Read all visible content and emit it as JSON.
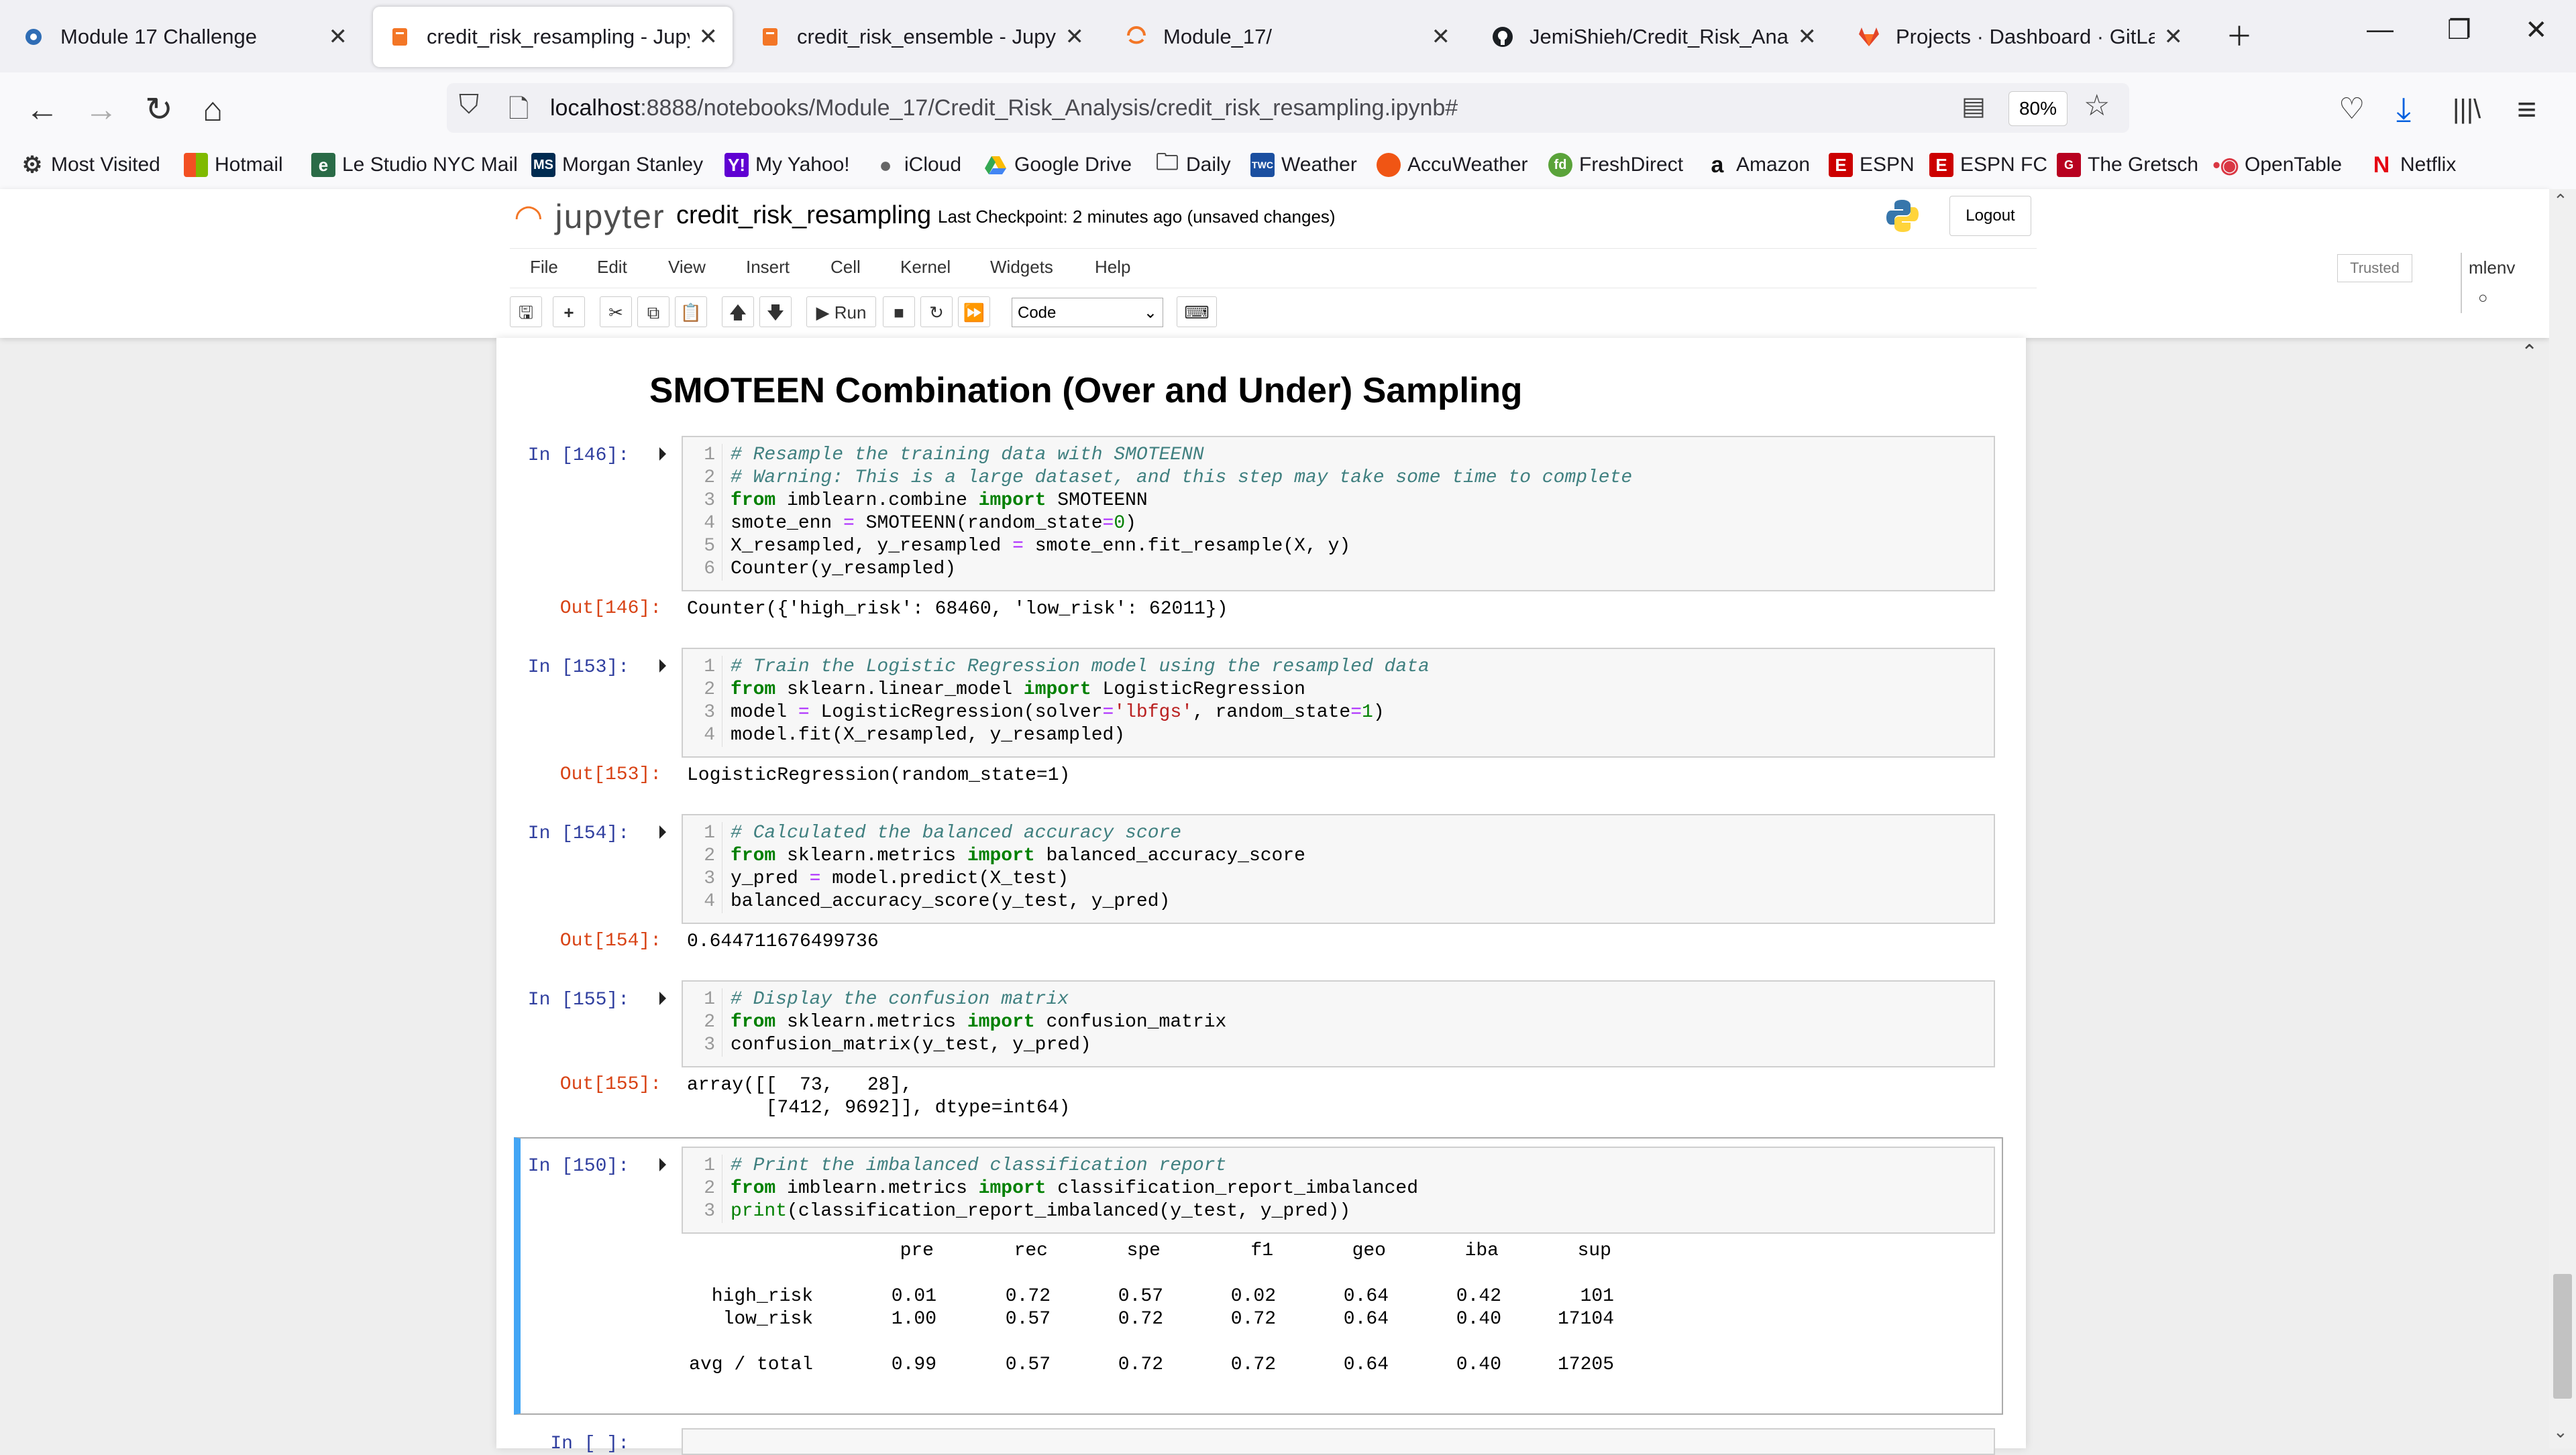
{
  "browser": {
    "tabs": [
      {
        "label": "Module 17 Challenge",
        "icon": "app-icon"
      },
      {
        "label": "credit_risk_resampling - Jupyte",
        "icon": "jupyter-icon",
        "active": true
      },
      {
        "label": "credit_risk_ensemble - Jupyter",
        "icon": "jupyter-icon"
      },
      {
        "label": "Module_17/",
        "icon": "jupyter-loading-icon"
      },
      {
        "label": "JemiShieh/Credit_Risk_Analysis",
        "icon": "github-icon"
      },
      {
        "label": "Projects · Dashboard · GitLab",
        "icon": "gitlab-icon"
      }
    ],
    "url_host": "localhost",
    "url_rest": ":8888/notebooks/Module_17/Credit_Risk_Analysis/credit_risk_resampling.ipynb#",
    "zoom": "80%",
    "bookmarks": [
      "Most Visited",
      "Hotmail",
      "Le Studio NYC Mail",
      "Morgan Stanley",
      "My Yahoo!",
      "iCloud",
      "Google Drive",
      "Daily",
      "Weather",
      "AccuWeather",
      "FreshDirect",
      "Amazon",
      "ESPN",
      "ESPN FC",
      "The Gretsch",
      "OpenTable",
      "Netflix"
    ]
  },
  "jupyter": {
    "logo": "jupyter",
    "notebook_name": "credit_risk_resampling",
    "checkpoint": "Last Checkpoint: 2 minutes ago  (unsaved changes)",
    "logout": "Logout",
    "menu": [
      "File",
      "Edit",
      "View",
      "Insert",
      "Cell",
      "Kernel",
      "Widgets",
      "Help"
    ],
    "trusted": "Trusted",
    "kernel": "mlenv",
    "run_label": "Run",
    "cell_type": "Code"
  },
  "notebook": {
    "heading": "SMOTEEN Combination (Over and Under) Sampling",
    "cells": [
      {
        "in": "In [146]:",
        "lines": [
          "# Resample the training data with SMOTEENN",
          "# Warning: This is a large dataset, and this step may take some time to complete",
          "from imblearn.combine import SMOTEENN",
          "smote_enn = SMOTEENN(random_state=0)",
          "X_resampled, y_resampled = smote_enn.fit_resample(X, y)",
          "Counter(y_resampled)"
        ],
        "out_label": "Out[146]:",
        "output": "Counter({'high_risk': 68460, 'low_risk': 62011})"
      },
      {
        "in": "In [153]:",
        "lines": [
          "# Train the Logistic Regression model using the resampled data",
          "from sklearn.linear_model import LogisticRegression",
          "model = LogisticRegression(solver='lbfgs', random_state=1)",
          "model.fit(X_resampled, y_resampled)"
        ],
        "out_label": "Out[153]:",
        "output": "LogisticRegression(random_state=1)"
      },
      {
        "in": "In [154]:",
        "lines": [
          "# Calculated the balanced accuracy score",
          "from sklearn.metrics import balanced_accuracy_score",
          "y_pred = model.predict(X_test)",
          "balanced_accuracy_score(y_test, y_pred)"
        ],
        "out_label": "Out[154]:",
        "output": "0.644711676499736"
      },
      {
        "in": "In [155]:",
        "lines": [
          "# Display the confusion matrix",
          "from sklearn.metrics import confusion_matrix",
          "confusion_matrix(y_test, y_pred)"
        ],
        "out_label": "Out[155]:",
        "output": "array([[  73,   28],\n       [7412, 9692]], dtype=int64)"
      },
      {
        "in": "In [150]:",
        "lines": [
          "# Print the imbalanced classification report",
          "from imblearn.metrics import classification_report_imbalanced",
          "print(classification_report_imbalanced(y_test, y_pred))"
        ]
      }
    ],
    "report": {
      "headers": [
        "pre",
        "rec",
        "spe",
        "f1",
        "geo",
        "iba",
        "sup"
      ],
      "rows": [
        {
          "label": "high_risk",
          "values": [
            "0.01",
            "0.72",
            "0.57",
            "0.02",
            "0.64",
            "0.42",
            "101"
          ]
        },
        {
          "label": "low_risk",
          "values": [
            "1.00",
            "0.57",
            "0.72",
            "0.72",
            "0.64",
            "0.40",
            "17104"
          ]
        },
        {
          "label": "avg / total",
          "values": [
            "0.99",
            "0.57",
            "0.72",
            "0.72",
            "0.64",
            "0.40",
            "17205"
          ]
        }
      ]
    },
    "next_in": "In [ ]:"
  }
}
